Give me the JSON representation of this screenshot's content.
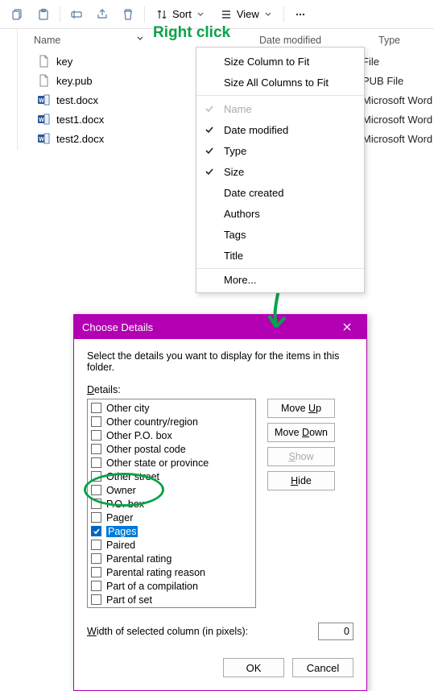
{
  "toolbar": {
    "sort_label": "Sort",
    "view_label": "View"
  },
  "columns": {
    "name": "Name",
    "date": "Date modified",
    "type": "Type"
  },
  "files": [
    {
      "name": "key",
      "type": "File",
      "icon": "file"
    },
    {
      "name": "key.pub",
      "type": "PUB File",
      "icon": "file"
    },
    {
      "name": "test.docx",
      "type": "Microsoft Word",
      "icon": "word"
    },
    {
      "name": "test1.docx",
      "type": "Microsoft Word",
      "icon": "word"
    },
    {
      "name": "test2.docx",
      "type": "Microsoft Word",
      "icon": "word"
    }
  ],
  "annotation": {
    "right_click": "Right click"
  },
  "ctx": {
    "fit": "Size Column to Fit",
    "fit_all": "Size All Columns to Fit",
    "name": "Name",
    "date": "Date modified",
    "type": "Type",
    "size": "Size",
    "created": "Date created",
    "authors": "Authors",
    "tags": "Tags",
    "title": "Title",
    "more": "More..."
  },
  "dlg": {
    "title": "Choose Details",
    "instr": "Select the details you want to display for the items in this folder.",
    "details_label": "Details:",
    "width_label": "Width of selected column (in pixels):",
    "width_value": "0",
    "btn_up": "Move Up",
    "btn_down": "Move Down",
    "btn_show": "Show",
    "btn_hide": "Hide",
    "btn_ok": "OK",
    "btn_cancel": "Cancel",
    "items": [
      {
        "label": "Other city",
        "checked": false
      },
      {
        "label": "Other country/region",
        "checked": false
      },
      {
        "label": "Other P.O. box",
        "checked": false
      },
      {
        "label": "Other postal code",
        "checked": false
      },
      {
        "label": "Other state or province",
        "checked": false
      },
      {
        "label": "Other street",
        "checked": false
      },
      {
        "label": "Owner",
        "checked": false
      },
      {
        "label": "P.O. box",
        "checked": false
      },
      {
        "label": "Pager",
        "checked": false
      },
      {
        "label": "Pages",
        "checked": true,
        "selected": true
      },
      {
        "label": "Paired",
        "checked": false
      },
      {
        "label": "Parental rating",
        "checked": false
      },
      {
        "label": "Parental rating reason",
        "checked": false
      },
      {
        "label": "Part of a compilation",
        "checked": false
      },
      {
        "label": "Part of set",
        "checked": false
      }
    ]
  }
}
